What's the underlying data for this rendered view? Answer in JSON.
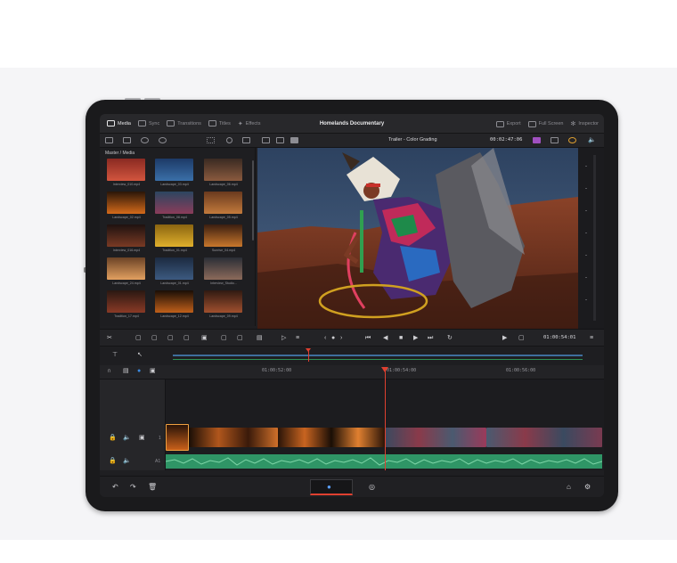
{
  "project_title": "Homelands Documentary",
  "top_nav": {
    "media": "Media",
    "sync": "Sync",
    "transitions": "Transitions",
    "titles": "Titles",
    "effects": "Effects",
    "export": "Export",
    "full_screen": "Full Screen",
    "inspector": "Inspector"
  },
  "viewer": {
    "timeline_name": "Trailer - Color Grading",
    "timecode": "00:02:47:06"
  },
  "media_pool": {
    "title": "Master / Media",
    "clips": [
      {
        "label": "Interview_010.mp4",
        "colors": [
          "#8a2a22",
          "#d2553e"
        ]
      },
      {
        "label": "Landscape_03.mp4",
        "colors": [
          "#1d3a67",
          "#3a6fa8"
        ]
      },
      {
        "label": "Landscape_06.mp4",
        "colors": [
          "#3a2a22",
          "#8a5a3e"
        ]
      },
      {
        "label": "Landscape_02.mp4",
        "colors": [
          "#2a1608",
          "#d46a1a"
        ]
      },
      {
        "label": "Tradition_08.mp4",
        "colors": [
          "#2c4660",
          "#8a3c5a"
        ]
      },
      {
        "label": "Landscape_05.mp4",
        "colors": [
          "#6a3a1e",
          "#c27a3c"
        ]
      },
      {
        "label": "Interview_016.mp4",
        "colors": [
          "#1e1210",
          "#7a3a24"
        ]
      },
      {
        "label": "Tradition_01.mp4",
        "colors": [
          "#8a6410",
          "#e0b02c"
        ]
      },
      {
        "label": "Sunrise_04.mp4",
        "colors": [
          "#3a1e10",
          "#c8772c"
        ]
      },
      {
        "label": "Landscape_24.mp4",
        "colors": [
          "#6a4226",
          "#e2a060"
        ]
      },
      {
        "label": "Landscape_01.mp4",
        "colors": [
          "#1c2a40",
          "#3c5a80"
        ]
      },
      {
        "label": "Interview_Studio...",
        "colors": [
          "#2a2e36",
          "#8c6a5a"
        ]
      },
      {
        "label": "Tradition_17.mp4",
        "colors": [
          "#2a1812",
          "#8a3a26"
        ]
      },
      {
        "label": "Landscape_12.mp4",
        "colors": [
          "#1a0e06",
          "#c0601a"
        ]
      },
      {
        "label": "Landscape_09.mp4",
        "colors": [
          "#301a12",
          "#a0502e"
        ]
      }
    ]
  },
  "transport": {
    "timecode": "01:00:54:01"
  },
  "timeline": {
    "ruler_labels": [
      "01:00:52:00",
      "01:00:54:00",
      "01:00:56:00"
    ],
    "video_track": "1",
    "audio_track": "A1"
  }
}
